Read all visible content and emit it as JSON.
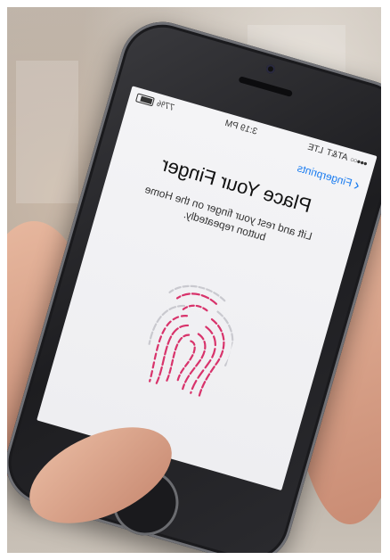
{
  "status_bar": {
    "carrier": "AT&T",
    "network": "LTE",
    "time": "3:19 PM",
    "battery": "77%"
  },
  "nav": {
    "back_label": "Fingerprints",
    "back_icon": "chevron-left-icon"
  },
  "content": {
    "title": "Place Your Finger",
    "subtitle": "Lift and rest your finger on the Home button repeatedly."
  },
  "colors": {
    "accent": "#1a7cf0",
    "fingerprint_active": "#d8336b",
    "fingerprint_inactive": "#c9c9cf"
  }
}
